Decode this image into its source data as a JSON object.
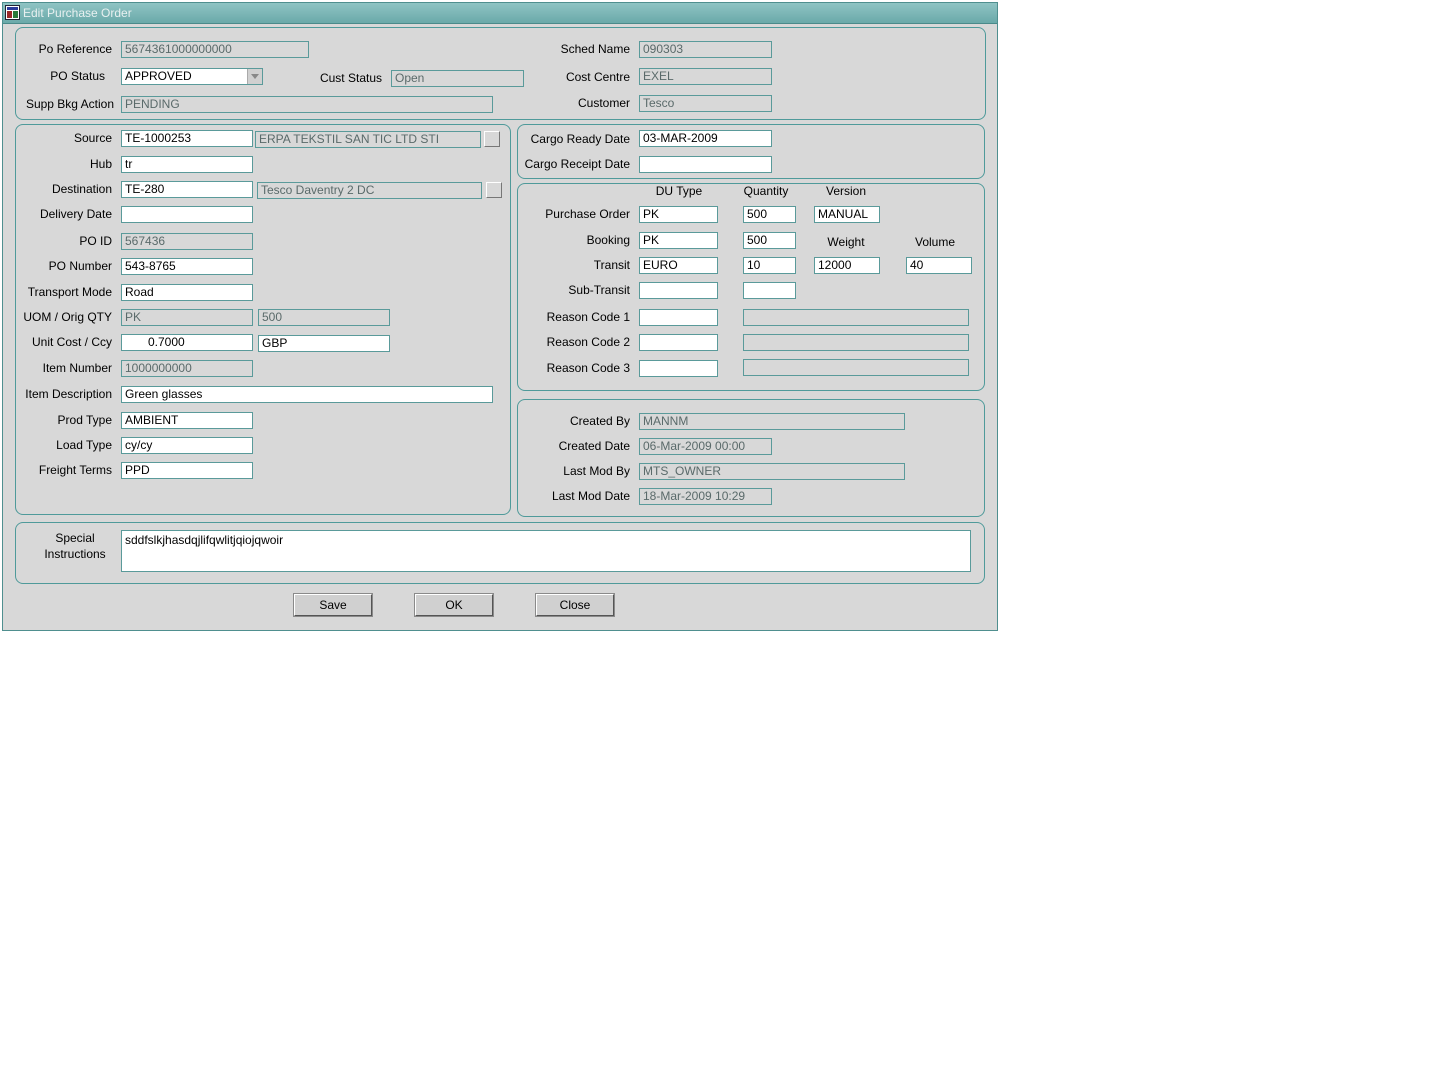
{
  "window": {
    "title": "Edit Purchase Order",
    "icon": "app-icon"
  },
  "header": {
    "po_reference": {
      "label": "Po Reference",
      "value": "5674361000000000"
    },
    "po_status": {
      "label": "PO Status",
      "value": "APPROVED"
    },
    "cust_status": {
      "label": "Cust Status",
      "value": "Open"
    },
    "supp_bkg_action": {
      "label": "Supp Bkg Action",
      "value": "PENDING"
    },
    "sched_name": {
      "label": "Sched Name",
      "value": "090303"
    },
    "cost_centre": {
      "label": "Cost Centre",
      "value": "EXEL"
    },
    "customer": {
      "label": "Customer",
      "value": "Tesco"
    }
  },
  "details": {
    "source": {
      "label": "Source",
      "code": "TE-1000253",
      "name": "ERPA TEKSTIL SAN  TIC  LTD  STI"
    },
    "hub": {
      "label": "Hub",
      "value": "tr"
    },
    "destination": {
      "label": "Destination",
      "code": "TE-280",
      "name": "Tesco Daventry 2 DC"
    },
    "delivery_date": {
      "label": "Delivery Date",
      "value": ""
    },
    "po_id": {
      "label": "PO ID",
      "value": "567436"
    },
    "po_number": {
      "label": "PO Number",
      "value": "543-8765"
    },
    "transport_mode": {
      "label": "Transport Mode",
      "value": "Road"
    },
    "uom_orig_qty": {
      "label": "UOM / Orig QTY",
      "uom": "PK",
      "qty": "500"
    },
    "unit_cost_ccy": {
      "label": "Unit Cost / Ccy",
      "cost": "0.7000",
      "ccy": "GBP"
    },
    "item_number": {
      "label": "Item Number",
      "value": "1000000000"
    },
    "item_description": {
      "label": "Item Description",
      "value": "Green glasses"
    },
    "prod_type": {
      "label": "Prod Type",
      "value": "AMBIENT"
    },
    "load_type": {
      "label": "Load Type",
      "value": "cy/cy"
    },
    "freight_terms": {
      "label": "Freight Terms",
      "value": "PPD"
    }
  },
  "cargo": {
    "ready_date": {
      "label": "Cargo Ready Date",
      "value": "03-MAR-2009"
    },
    "receipt_date": {
      "label": "Cargo Receipt Date",
      "value": ""
    }
  },
  "quantities": {
    "headers": {
      "du_type": "DU Type",
      "quantity": "Quantity",
      "version": "Version",
      "weight": "Weight",
      "volume": "Volume"
    },
    "purchase_order": {
      "label": "Purchase Order",
      "du_type": "PK",
      "quantity": "500",
      "version": "MANUAL"
    },
    "booking": {
      "label": "Booking",
      "du_type": "PK",
      "quantity": "500"
    },
    "transit": {
      "label": "Transit",
      "du_type": "EURO",
      "quantity": "10",
      "weight": "12000",
      "volume": "40"
    },
    "sub_transit": {
      "label": "Sub-Transit",
      "du_type": "",
      "quantity": ""
    },
    "reason_code_1": {
      "label": "Reason Code 1",
      "code": "",
      "desc": ""
    },
    "reason_code_2": {
      "label": "Reason Code 2",
      "code": "",
      "desc": ""
    },
    "reason_code_3": {
      "label": "Reason Code 3",
      "code": "",
      "desc": ""
    }
  },
  "audit": {
    "created_by": {
      "label": "Created By",
      "value": "MANNM"
    },
    "created_date": {
      "label": "Created Date",
      "value": "06-Mar-2009 00:00"
    },
    "last_mod_by": {
      "label": "Last Mod By",
      "value": "MTS_OWNER"
    },
    "last_mod_date": {
      "label": "Last Mod Date",
      "value": "18-Mar-2009 10:29"
    }
  },
  "special": {
    "label_line1": "Special",
    "label_line2": "Instructions",
    "value": "sddfslkjhasdqjlifqwlitjqiojqwoir"
  },
  "buttons": {
    "save": "Save",
    "ok": "OK",
    "close": "Close"
  }
}
